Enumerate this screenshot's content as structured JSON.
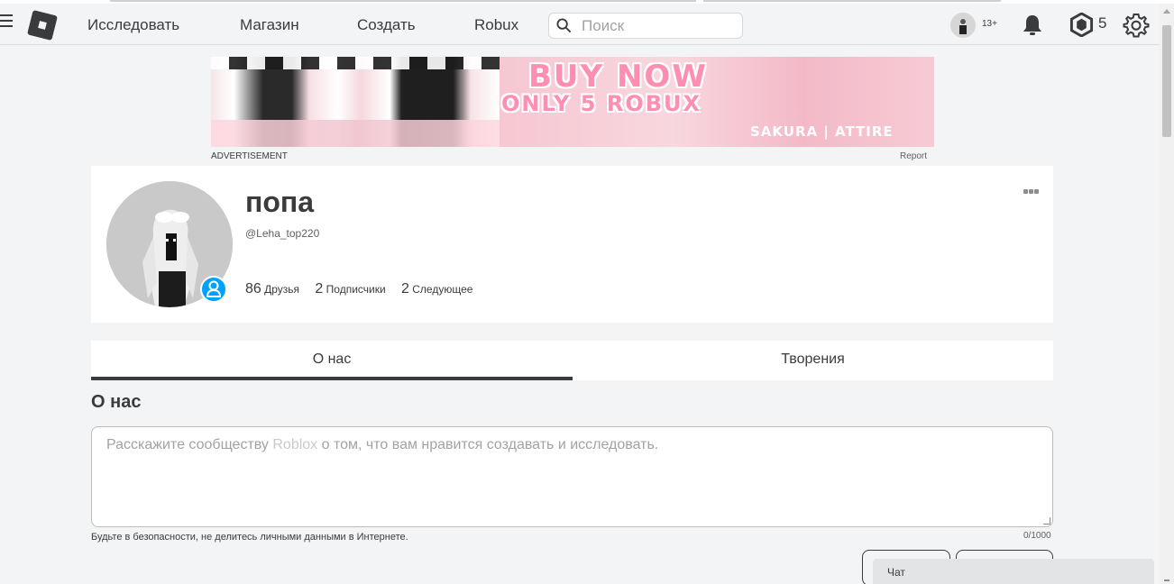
{
  "nav": {
    "links": [
      "Исследовать",
      "Магазин",
      "Создать",
      "Robux"
    ],
    "search_placeholder": "Поиск",
    "age_badge": "13+",
    "robux_count": "5"
  },
  "ad": {
    "line1": "BUY NOW",
    "line2": "ONLY 5 ROBUX",
    "brand": "SAKURA | ATTIRE",
    "label": "ADVERTISEMENT",
    "report": "Report"
  },
  "profile": {
    "display_name": "попа",
    "username": "@Leha_top220",
    "friends_count": "86",
    "friends_label": "Друзья",
    "followers_count": "2",
    "followers_label": "Подписчики",
    "following_count": "2",
    "following_label": "Следующее"
  },
  "tabs": [
    "О нас",
    "Творения"
  ],
  "about": {
    "heading": "О нас",
    "placeholder_before": "Расскажите сообществу ",
    "placeholder_brand": "Roblox",
    "placeholder_after": " о том, что вам нравится создавать и исследовать.",
    "safety_note": "Будьте в безопасности, не делитесь личными данными в Интернете.",
    "char_count": "0/1000"
  },
  "chat": {
    "label": "Чат"
  },
  "colors": {
    "accent": "#393b3d",
    "presence": "#00a2ff",
    "ad_pink": "#ff8fb2"
  }
}
